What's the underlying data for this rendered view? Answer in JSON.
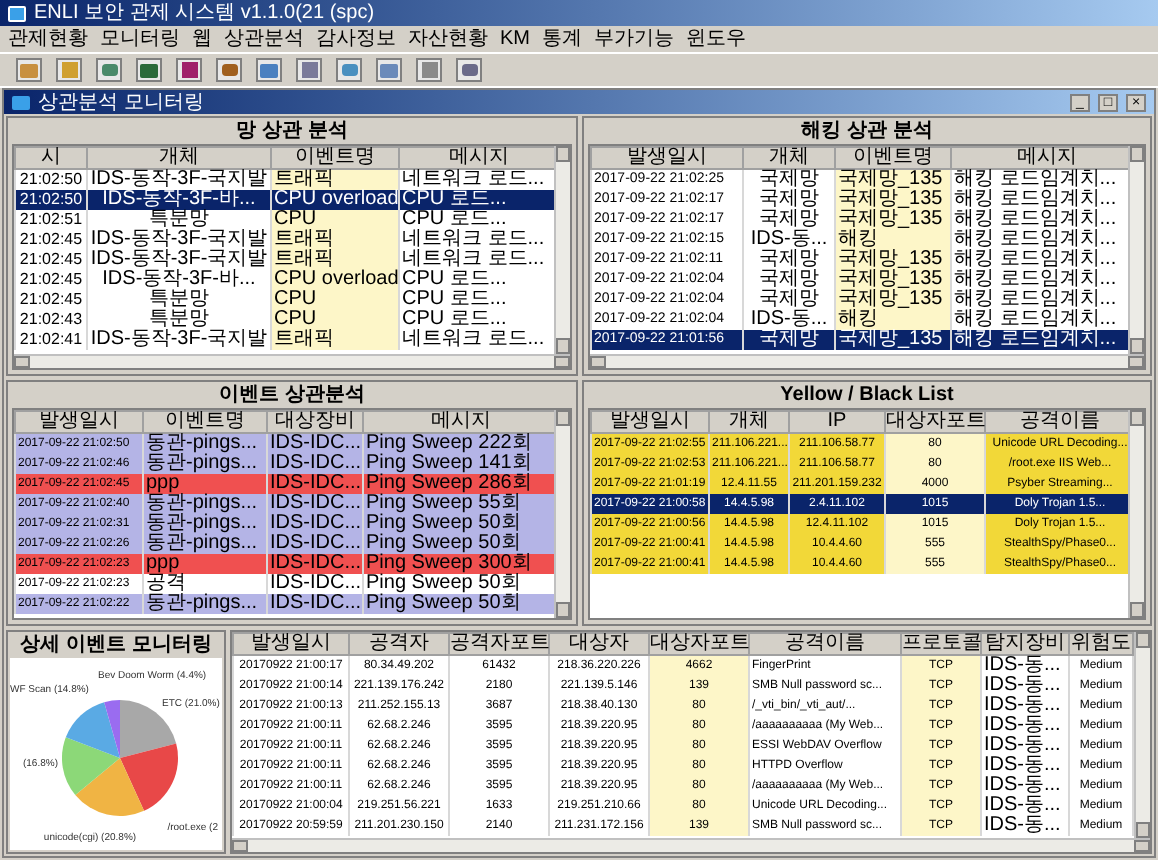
{
  "window": {
    "title": "ENLI 보안 관제 시스템 v1.1.0(21 (spc)"
  },
  "menu": [
    "관제현황",
    "모니터링",
    "웹",
    "상관분석",
    "감사정보",
    "자산현황",
    "KM",
    "통계",
    "부가기능",
    "윈도우"
  ],
  "child_window": {
    "title": "상관분석 모니터링",
    "controls": [
      "_",
      "□",
      "×"
    ]
  },
  "network_correlation": {
    "title": "망 상관 분석",
    "columns": [
      "시",
      "개체",
      "이벤트명",
      "메시지"
    ],
    "rows": [
      {
        "cells": [
          "21:02:50",
          "IDS-동작-3F-국지발",
          "트래픽",
          "네트워크 로드..."
        ],
        "selected": false
      },
      {
        "cells": [
          "21:02:50",
          "IDS-동작-3F-바...",
          "CPU overload",
          "CPU 로드..."
        ],
        "selected": true
      },
      {
        "cells": [
          "21:02:51",
          "특분망",
          "CPU",
          "CPU 로드..."
        ],
        "selected": false
      },
      {
        "cells": [
          "21:02:45",
          "IDS-동작-3F-국지발",
          "트래픽",
          "네트워크 로드..."
        ],
        "selected": false
      },
      {
        "cells": [
          "21:02:45",
          "IDS-동작-3F-국지발",
          "트래픽",
          "네트워크 로드..."
        ],
        "selected": false
      },
      {
        "cells": [
          "21:02:45",
          "IDS-동작-3F-바...",
          "CPU overload",
          "CPU 로드..."
        ],
        "selected": false
      },
      {
        "cells": [
          "21:02:45",
          "특분망",
          "CPU",
          "CPU 로드..."
        ],
        "selected": false
      },
      {
        "cells": [
          "21:02:43",
          "특분망",
          "CPU",
          "CPU 로드..."
        ],
        "selected": false
      },
      {
        "cells": [
          "21:02:41",
          "IDS-동작-3F-국지발",
          "트래픽",
          "네트워크 로드..."
        ],
        "selected": false
      }
    ]
  },
  "hacking_correlation": {
    "title": "해킹 상관 분석",
    "columns": [
      "발생일시",
      "개체",
      "이벤트명",
      "메시지"
    ],
    "rows": [
      {
        "cells": [
          "2017-09-22 21:02:25",
          "국제망",
          "국제망_135",
          "해킹 로드임계치..."
        ],
        "selected": false
      },
      {
        "cells": [
          "2017-09-22 21:02:17",
          "국제망",
          "국제망_135",
          "해킹 로드임계치..."
        ],
        "selected": false
      },
      {
        "cells": [
          "2017-09-22 21:02:17",
          "국제망",
          "국제망_135",
          "해킹 로드임계치..."
        ],
        "selected": false
      },
      {
        "cells": [
          "2017-09-22 21:02:15",
          "IDS-동...",
          "해킹",
          "해킹 로드임계치..."
        ],
        "selected": false
      },
      {
        "cells": [
          "2017-09-22 21:02:11",
          "국제망",
          "국제망_135",
          "해킹 로드임계치..."
        ],
        "selected": false
      },
      {
        "cells": [
          "2017-09-22 21:02:04",
          "국제망",
          "국제망_135",
          "해킹 로드임계치..."
        ],
        "selected": false
      },
      {
        "cells": [
          "2017-09-22 21:02:04",
          "국제망",
          "국제망_135",
          "해킹 로드임계치..."
        ],
        "selected": false
      },
      {
        "cells": [
          "2017-09-22 21:02:04",
          "IDS-동...",
          "해킹",
          "해킹 로드임계치..."
        ],
        "selected": false
      },
      {
        "cells": [
          "2017-09-22 21:01:56",
          "국제망",
          "국제망_135",
          "해킹 로드임계치..."
        ],
        "selected": true
      }
    ]
  },
  "event_correlation": {
    "title": "이벤트 상관분석",
    "columns": [
      "발생일시",
      "이벤트명",
      "대상장비",
      "메시지"
    ],
    "rows": [
      {
        "cells": [
          "2017-09-22 21:02:50",
          "동관-pings...",
          "IDS-IDC...",
          "Ping Sweep 222회"
        ],
        "color": "#b4b4e6"
      },
      {
        "cells": [
          "2017-09-22 21:02:46",
          "동관-pings...",
          "IDS-IDC...",
          "Ping Sweep 141회"
        ],
        "color": "#b4b4e6"
      },
      {
        "cells": [
          "2017-09-22 21:02:45",
          "ppp",
          "IDS-IDC...",
          "Ping Sweep 286회"
        ],
        "color": "#f05050"
      },
      {
        "cells": [
          "2017-09-22 21:02:40",
          "동관-pings...",
          "IDS-IDC...",
          "Ping Sweep 55회"
        ],
        "color": "#b4b4e6"
      },
      {
        "cells": [
          "2017-09-22 21:02:31",
          "동관-pings...",
          "IDS-IDC...",
          "Ping Sweep 50회"
        ],
        "color": "#b4b4e6"
      },
      {
        "cells": [
          "2017-09-22 21:02:26",
          "동관-pings...",
          "IDS-IDC...",
          "Ping Sweep 50회"
        ],
        "color": "#b4b4e6"
      },
      {
        "cells": [
          "2017-09-22 21:02:23",
          "ppp",
          "IDS-IDC...",
          "Ping Sweep 300회"
        ],
        "color": "#f05050"
      },
      {
        "cells": [
          "2017-09-22 21:02:23",
          "공격",
          "IDS-IDC...",
          "Ping Sweep 50회"
        ],
        "color": "#ffffff"
      },
      {
        "cells": [
          "2017-09-22 21:02:22",
          "동관-pings...",
          "IDS-IDC...",
          "Ping Sweep 50회"
        ],
        "color": "#b4b4e6"
      }
    ]
  },
  "yellow_black_list": {
    "title": "Yellow / Black List",
    "columns": [
      "발생일시",
      "개체",
      "IP",
      "대상자포트",
      "공격이름"
    ],
    "rows": [
      {
        "cells": [
          "2017-09-22 21:02:55",
          "211.106.221...",
          "211.106.58.77",
          "80",
          "Unicode URL Decoding..."
        ],
        "selected": false
      },
      {
        "cells": [
          "2017-09-22 21:02:53",
          "211.106.221...",
          "211.106.58.77",
          "80",
          "/root.exe IIS Web..."
        ],
        "selected": false
      },
      {
        "cells": [
          "2017-09-22 21:01:19",
          "12.4.11.55",
          "211.201.159.232",
          "4000",
          "Psyber Streaming..."
        ],
        "selected": false
      },
      {
        "cells": [
          "2017-09-22 21:00:58",
          "14.4.5.98",
          "2.4.11.102",
          "1015",
          "Doly Trojan 1.5..."
        ],
        "selected": true
      },
      {
        "cells": [
          "2017-09-22 21:00:56",
          "14.4.5.98",
          "12.4.11.102",
          "1015",
          "Doly Trojan 1.5..."
        ],
        "selected": false
      },
      {
        "cells": [
          "2017-09-22 21:00:41",
          "14.4.5.98",
          "10.4.4.60",
          "555",
          "StealthSpy/Phase0..."
        ],
        "selected": false
      },
      {
        "cells": [
          "2017-09-22 21:00:41",
          "14.4.5.98",
          "10.4.4.60",
          "555",
          "StealthSpy/Phase0..."
        ],
        "selected": false
      }
    ]
  },
  "event_detail": {
    "title": "상세 이벤트 모니터링",
    "chart_data": {
      "type": "pie",
      "categories": [
        "ETC (21.0%)",
        "/root.exe (2",
        "unicode(cgi) (20.8%)",
        "(16.8%)",
        "WF Scan (14.8%)",
        "Bev Doom Worm (4.4%)"
      ],
      "values": [
        21.0,
        22.2,
        20.8,
        16.8,
        14.8,
        4.4
      ],
      "colors": [
        "#a8a8a8",
        "#e84848",
        "#f0b444",
        "#8cd878",
        "#5aaae4",
        "#9a6cf0"
      ]
    },
    "columns": [
      "발생일시",
      "공격자",
      "공격자포트",
      "대상자",
      "대상자포트",
      "공격이름",
      "프로토콜",
      "탐지장비",
      "위험도"
    ],
    "rows": [
      {
        "cells": [
          "20170922 21:00:17",
          "80.34.49.202",
          "61432",
          "218.36.220.226",
          "4662",
          "FingerPrint",
          "TCP",
          "IDS-동...",
          "Medium"
        ]
      },
      {
        "cells": [
          "20170922 21:00:14",
          "221.139.176.242",
          "2180",
          "221.139.5.146",
          "139",
          "SMB Null password sc...",
          "TCP",
          "IDS-동...",
          "Medium"
        ]
      },
      {
        "cells": [
          "20170922 21:00:13",
          "211.252.155.13",
          "3687",
          "218.38.40.130",
          "80",
          "/_vti_bin/_vti_aut/...",
          "TCP",
          "IDS-동...",
          "Medium"
        ]
      },
      {
        "cells": [
          "20170922 21:00:11",
          "62.68.2.246",
          "3595",
          "218.39.220.95",
          "80",
          "/aaaaaaaaaa (My Web...",
          "TCP",
          "IDS-동...",
          "Medium"
        ]
      },
      {
        "cells": [
          "20170922 21:00:11",
          "62.68.2.246",
          "3595",
          "218.39.220.95",
          "80",
          "ESSI WebDAV Overflow",
          "TCP",
          "IDS-동...",
          "Medium"
        ]
      },
      {
        "cells": [
          "20170922 21:00:11",
          "62.68.2.246",
          "3595",
          "218.39.220.95",
          "80",
          "HTTPD Overflow",
          "TCP",
          "IDS-동...",
          "Medium"
        ]
      },
      {
        "cells": [
          "20170922 21:00:11",
          "62.68.2.246",
          "3595",
          "218.39.220.95",
          "80",
          "/aaaaaaaaaa (My Web...",
          "TCP",
          "IDS-동...",
          "Medium"
        ]
      },
      {
        "cells": [
          "20170922 21:00:04",
          "219.251.56.221",
          "1633",
          "219.251.210.66",
          "80",
          "Unicode URL Decoding...",
          "TCP",
          "IDS-동...",
          "Medium"
        ]
      },
      {
        "cells": [
          "20170922 20:59:59",
          "211.201.230.150",
          "2140",
          "211.231.172.156",
          "139",
          "SMB Null password sc...",
          "TCP",
          "IDS-동...",
          "Medium"
        ]
      }
    ]
  }
}
